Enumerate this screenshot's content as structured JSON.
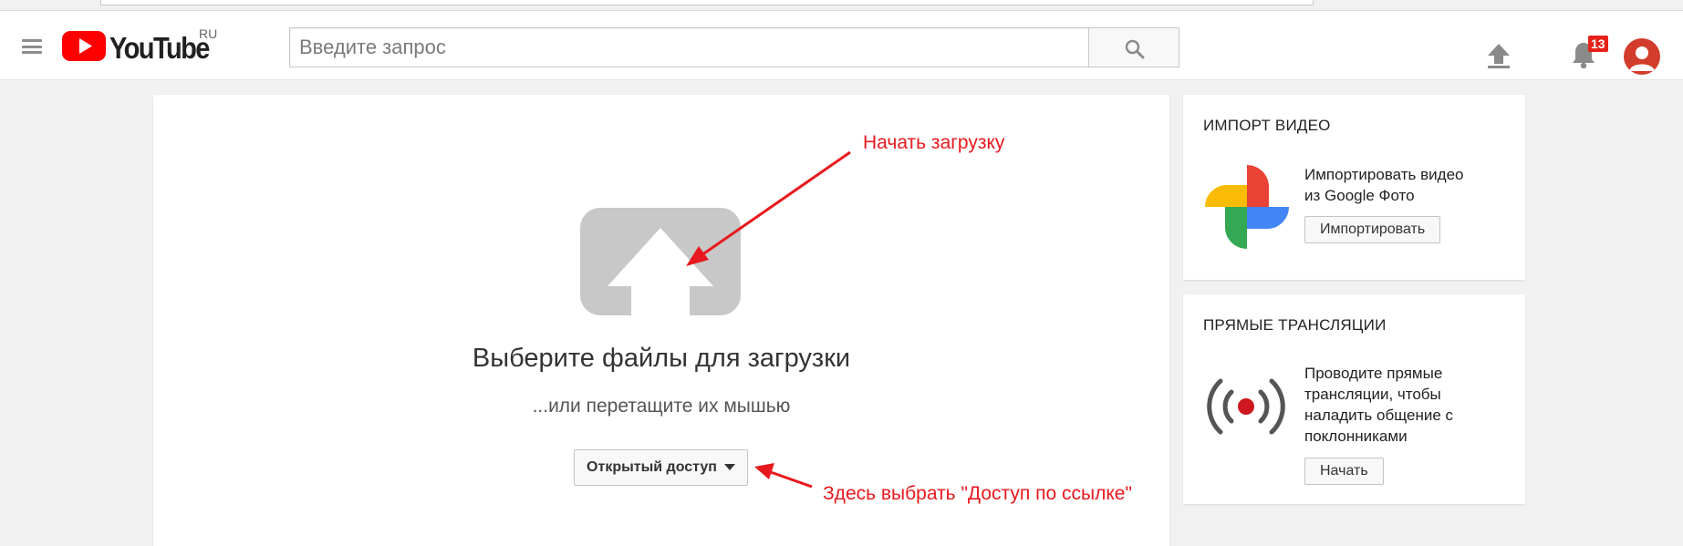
{
  "header": {
    "logo_text": "YouTube",
    "logo_region": "RU",
    "search_placeholder": "Введите запрос",
    "notification_count": "13"
  },
  "upload": {
    "title": "Выберите файлы для загрузки",
    "subtitle": "...или перетащите их мышью",
    "privacy_selected": "Открытый доступ"
  },
  "annotations": {
    "start_upload": "Начать загрузку",
    "choose_link_access": "Здесь выбрать \"Доступ по ссылке\""
  },
  "import_card": {
    "title": "ИМПОРТ ВИДЕО",
    "text_line1": "Импортировать видео",
    "text_line2": "из Google Фото",
    "button_label": "Импортировать"
  },
  "live_card": {
    "title": "ПРЯМЫЕ ТРАНСЛЯЦИИ",
    "text_line1": "Проводите прямые",
    "text_line2": "трансляции, чтобы",
    "text_line3": "наладить общение с",
    "text_line4": "поклонниками",
    "button_label": "Начать"
  },
  "colors": {
    "youtube_red": "#ff0000",
    "annotation_red": "#e8191e",
    "badge_red": "#e62117"
  }
}
